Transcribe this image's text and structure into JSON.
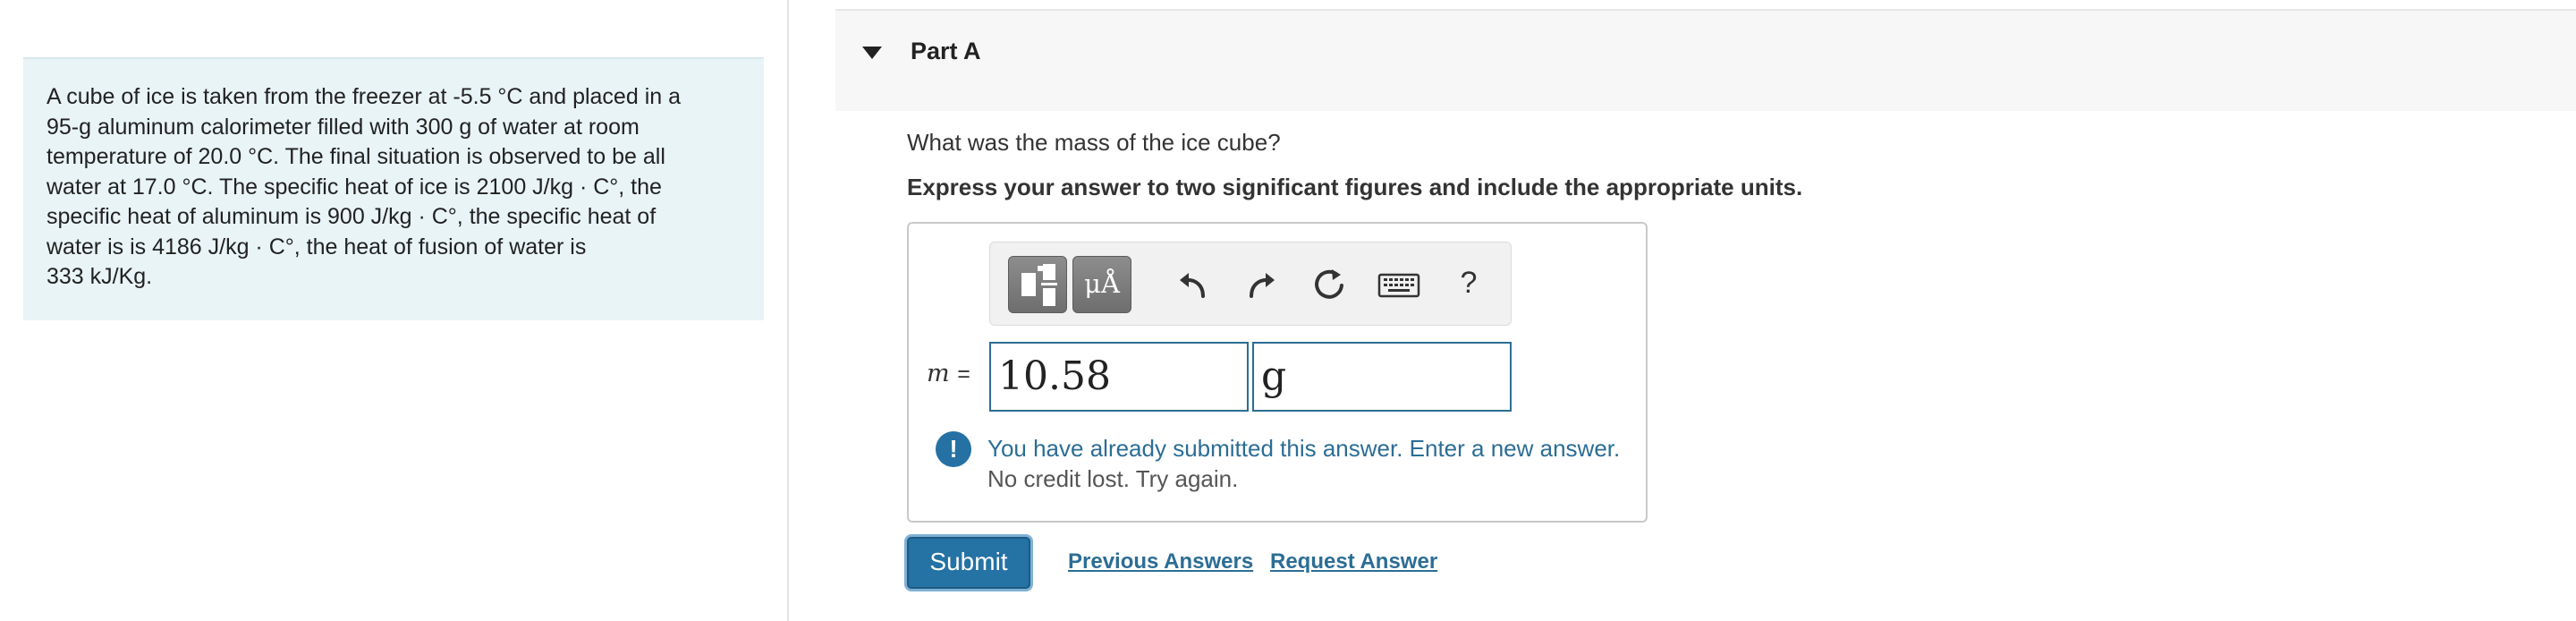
{
  "problem": {
    "lines": [
      "A cube of ice is taken from the freezer at -5.5 °C and placed in a",
      "95-g aluminum calorimeter filled with 300  g of water at room",
      "temperature of 20.0 °C. The final situation is observed to be all",
      "water at 17.0 °C. The specific heat of ice is 2100 J/kg · C°, the",
      "specific heat of aluminum is 900 J/kg · C°, the specific heat of",
      "water is is 4186 J/kg · C°, the heat of fusion of water is",
      "333 kJ/Kg."
    ]
  },
  "part": {
    "title": "Part A",
    "expanded": true
  },
  "question": "What was the mass of the ice cube?",
  "instruction": "Express your answer to two significant figures and include the appropriate units.",
  "toolbar": {
    "templates_icon": "templates-icon",
    "units_label": "μÅ",
    "undo_icon": "undo-icon",
    "redo_icon": "redo-icon",
    "reset_icon": "reset-icon",
    "keyboard_icon": "keyboard-icon",
    "help_label": "?"
  },
  "answer": {
    "variable": "m",
    "equals": "=",
    "value": "10.58",
    "units": "g"
  },
  "feedback": {
    "icon": "exclamation-icon",
    "message": "You have already submitted this answer. Enter a new answer.",
    "detail": "No credit lost. Try again."
  },
  "actions": {
    "submit": "Submit",
    "previous_answers": "Previous Answers",
    "request_answer": "Request Answer"
  },
  "colors": {
    "accent": "#2572a4",
    "problem_bg": "#e9f4f7",
    "feedback_text": "#2c6d95"
  }
}
